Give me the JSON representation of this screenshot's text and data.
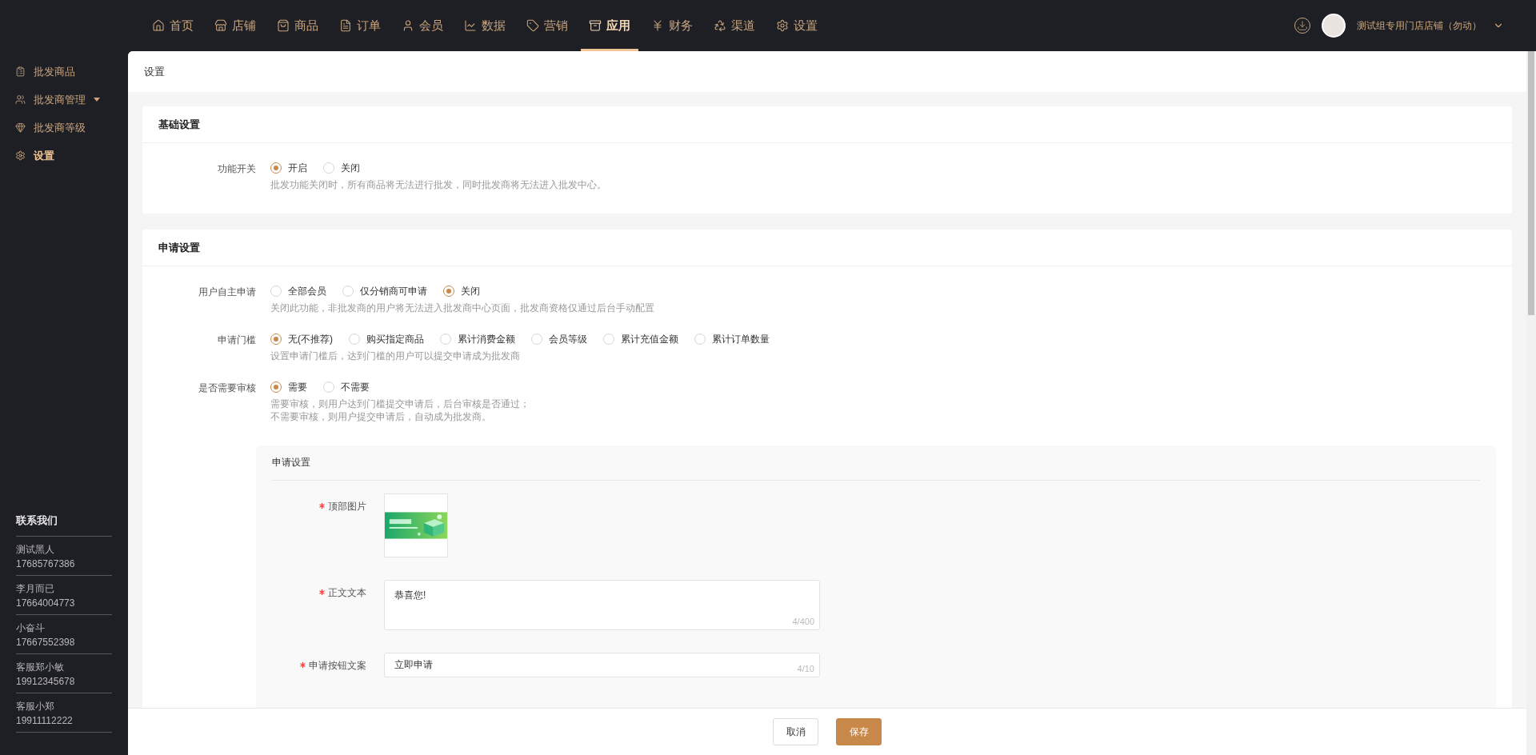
{
  "top_nav": {
    "items": [
      {
        "label": "首页",
        "selected": false
      },
      {
        "label": "店铺",
        "selected": false
      },
      {
        "label": "商品",
        "selected": false
      },
      {
        "label": "订单",
        "selected": false
      },
      {
        "label": "会员",
        "selected": false
      },
      {
        "label": "数据",
        "selected": false
      },
      {
        "label": "营销",
        "selected": false
      },
      {
        "label": "应用",
        "selected": true
      },
      {
        "label": "财务",
        "selected": false
      },
      {
        "label": "渠道",
        "selected": false
      },
      {
        "label": "设置",
        "selected": false
      }
    ],
    "account": {
      "name": "测试组专用门店店铺（勿动）"
    }
  },
  "sidebar": {
    "items": [
      {
        "label": "批发商品",
        "selected": false
      },
      {
        "label": "批发商管理",
        "selected": false,
        "expanded": false
      },
      {
        "label": "批发商等级",
        "selected": false
      },
      {
        "label": "设置",
        "selected": true
      }
    ],
    "contacts": {
      "title": "联系我们",
      "people": [
        {
          "name": "测试黑人",
          "phone": "17685767386"
        },
        {
          "name": "李月而已",
          "phone": "17664004773"
        },
        {
          "name": "小奋斗",
          "phone": "17667552398"
        },
        {
          "name": "客服郑小敏",
          "phone": "19912345678"
        },
        {
          "name": "客服小郑",
          "phone": "19911112222"
        }
      ]
    }
  },
  "page": {
    "title": "设置"
  },
  "sections": [
    {
      "title": "基础设置",
      "fields": [
        {
          "label": "功能开关",
          "options": [
            {
              "label": "开启",
              "selected": true
            },
            {
              "label": "关闭",
              "selected": false
            }
          ],
          "hint": [
            "批发功能关闭时，所有商品将无法进行批发，同时批发商将无法进入批发中心。"
          ]
        }
      ]
    },
    {
      "title": "申请设置",
      "fields": [
        {
          "label": "用户自主申请",
          "options": [
            {
              "label": "全部会员",
              "selected": false
            },
            {
              "label": "仅分销商可申请",
              "selected": false
            },
            {
              "label": "关闭",
              "selected": true
            }
          ],
          "hint": [
            "关闭此功能，非批发商的用户将无法进入批发商中心页面，批发商资格仅通过后台手动配置"
          ]
        },
        {
          "label": "申请门槛",
          "options": [
            {
              "label": "无(不推荐)",
              "selected": true
            },
            {
              "label": "购买指定商品",
              "selected": false
            },
            {
              "label": "累计消费金额",
              "selected": false
            },
            {
              "label": "会员等级",
              "selected": false
            },
            {
              "label": "累计充值金额",
              "selected": false
            },
            {
              "label": "累计订单数量",
              "selected": false
            }
          ],
          "hint": [
            "设置申请门槛后，达到门槛的用户可以提交申请成为批发商"
          ]
        },
        {
          "label": "是否需要审核",
          "options": [
            {
              "label": "需要",
              "selected": true
            },
            {
              "label": "不需要",
              "selected": false
            }
          ],
          "hint": [
            "需要审核，则用户达到门槛提交申请后，后台审核是否通过；",
            "不需要审核，则用户提交申请后，自动成为批发商。"
          ]
        }
      ],
      "subpanel": {
        "title": "申请设置",
        "fields": [
          {
            "label": "顶部图片",
            "required": true
          },
          {
            "kind": "textarea",
            "label": "正文文本",
            "required": true,
            "value": "恭喜您!",
            "counter": "4/400"
          },
          {
            "kind": "input",
            "label": "申请按钮文案",
            "required": true,
            "value": "立即申请",
            "counter": "4/10"
          }
        ]
      }
    }
  ],
  "footer": {
    "buttons": [
      {
        "label": "取消",
        "kind": "secondary"
      },
      {
        "label": "保存",
        "kind": "primary"
      }
    ]
  }
}
